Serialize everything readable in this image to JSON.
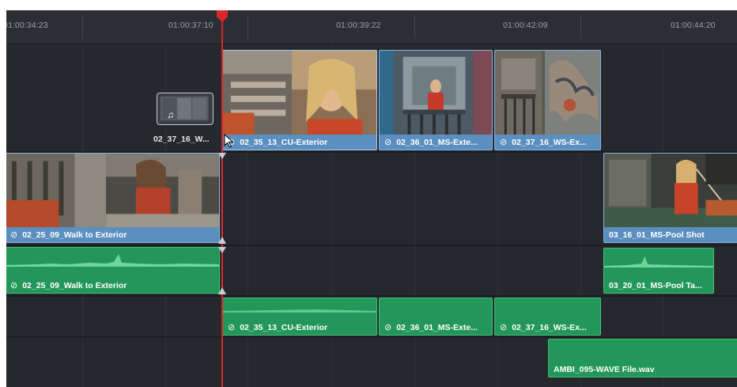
{
  "ruler": {
    "timecodes": [
      "01:00:34:23",
      "01:00:37:10",
      "01:00:39:22",
      "01:00:42:09",
      "01:00:44:20"
    ]
  },
  "playhead": {
    "color": "#d8282c"
  },
  "dragged_clip": {
    "label": "02_37_16_W...",
    "icon": "music-note-icon"
  },
  "video_clips": [
    {
      "name": "02_35_13_CU-Exterior",
      "linked": true
    },
    {
      "name": "02_36_01_MS-Exte...",
      "linked": true
    },
    {
      "name": "02_37_16_WS-Ex...",
      "linked": true
    },
    {
      "name": "02_25_09_Walk to Exterior",
      "linked": true
    },
    {
      "name": "03_16_01_MS-Pool Shot",
      "linked": false
    }
  ],
  "audio_clips": [
    {
      "name": "02_25_09_Walk to Exterior",
      "linked": true
    },
    {
      "name": "03_20_01_MS-Pool Ta...",
      "linked": false
    },
    {
      "name": "02_35_13_CU-Exterior",
      "linked": true
    },
    {
      "name": "02_36_01_MS-Exte...",
      "linked": true
    },
    {
      "name": "02_37_16_WS-Ex...",
      "linked": true
    },
    {
      "name": "AMBI_095-WAVE File.wav",
      "linked": false
    }
  ],
  "link_glyph": "⊘",
  "colors": {
    "timeline_bg": "#26282d",
    "video_clip": "#5b8fbf",
    "audio_clip": "#23975a",
    "playhead": "#d8282c"
  }
}
